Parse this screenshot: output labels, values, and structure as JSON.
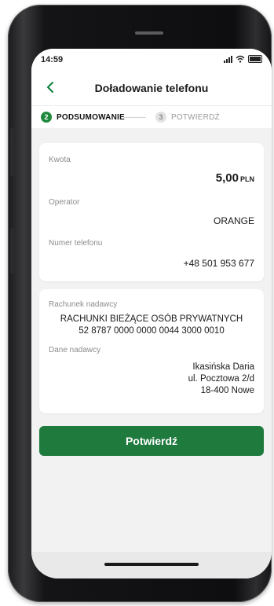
{
  "status": {
    "time": "14:59"
  },
  "header": {
    "title": "Doładowanie telefonu"
  },
  "stepper": {
    "step1": {
      "num": "2",
      "label": "PODSUMOWANIE"
    },
    "step2": {
      "num": "3",
      "label": "POTWIERDŹ"
    }
  },
  "summary": {
    "amount_label": "Kwota",
    "amount_value": "5,00",
    "amount_currency": "PLN",
    "operator_label": "Operator",
    "operator_value": "ORANGE",
    "phone_label": "Numer telefonu",
    "phone_value": "+48 501 953 677"
  },
  "sender": {
    "account_label": "Rachunek nadawcy",
    "account_name": "RACHUNKI BIEŻĄCE OSÓB PRYWATNYCH",
    "account_number": "52 8787 0000 0000 0044 3000 0010",
    "data_label": "Dane nadawcy",
    "name": "Ikasińska Daria",
    "street": "ul. Pocztowa 2/d",
    "city": "18-400 Nowe"
  },
  "actions": {
    "confirm_label": "Potwierdź"
  },
  "colors": {
    "accent": "#1f7a3e",
    "step_active": "#1f8a3d"
  },
  "icons": {
    "back": "chevron-left-icon"
  }
}
